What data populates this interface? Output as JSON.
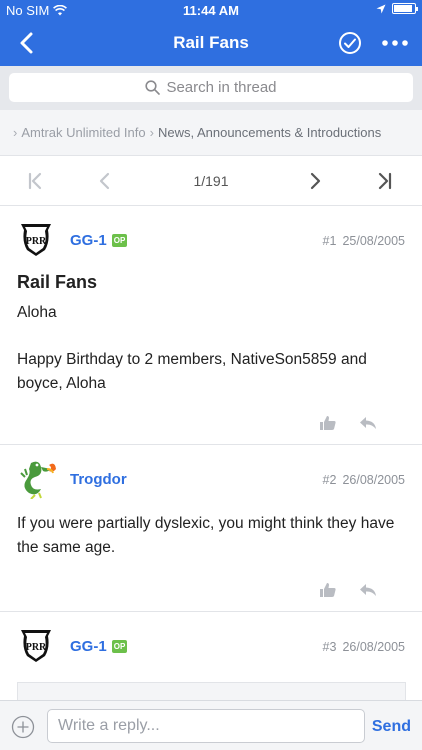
{
  "status": {
    "carrier": "No SIM",
    "time": "11:44 AM",
    "battery_level": 0.9
  },
  "nav": {
    "title": "Rail Fans",
    "back_icon": "chevron-left-icon",
    "check_icon": "check-circle-icon",
    "more_icon": "more-dots-icon"
  },
  "search": {
    "placeholder": "Search in thread"
  },
  "breadcrumb": {
    "items": [
      "›",
      "Amtrak Unlimited Info",
      "News, Announcements & Introductions"
    ]
  },
  "pager": {
    "page": "1/191"
  },
  "posts": [
    {
      "author": "GG-1",
      "op_badge": "OP",
      "number": "#1",
      "date": "25/08/2005",
      "title": "Rail Fans",
      "body_lines": [
        "Aloha",
        "Happy Birthday to 2 members, NativeSon5859 and boyce, Aloha"
      ]
    },
    {
      "author": "Trogdor",
      "number": "#2",
      "date": "26/08/2005",
      "body_lines": [
        "If you were partially dyslexic, you might think they have the same age."
      ]
    },
    {
      "author": "GG-1",
      "op_badge": "OP",
      "number": "#3",
      "date": "26/08/2005"
    }
  ],
  "reply": {
    "placeholder": "Write a reply...",
    "send_label": "Send"
  },
  "colors": {
    "brand": "#2f6fe0",
    "op_badge": "#6cc04a"
  }
}
